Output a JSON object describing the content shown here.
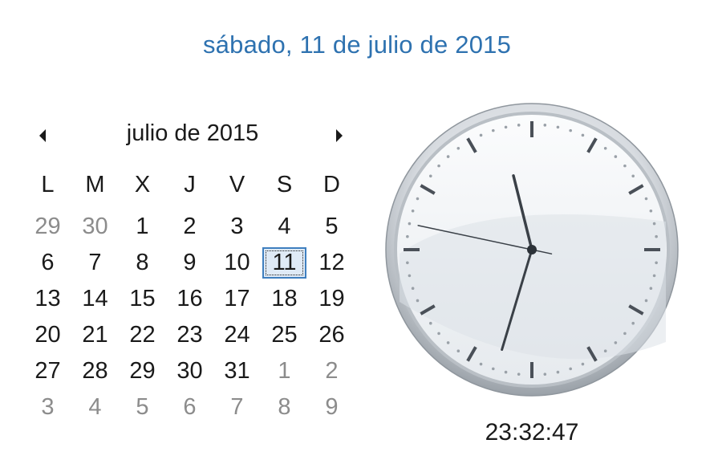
{
  "header": {
    "full_date": "sábado, 11 de julio de 2015"
  },
  "calendar": {
    "month_title": "julio de 2015",
    "prev_icon": "triangle-left",
    "next_icon": "triangle-right",
    "weekdays": [
      "L",
      "M",
      "X",
      "J",
      "V",
      "S",
      "D"
    ],
    "selected_day": "11",
    "days": [
      {
        "label": "29",
        "other": true
      },
      {
        "label": "30",
        "other": true
      },
      {
        "label": "1"
      },
      {
        "label": "2"
      },
      {
        "label": "3"
      },
      {
        "label": "4"
      },
      {
        "label": "5"
      },
      {
        "label": "6"
      },
      {
        "label": "7"
      },
      {
        "label": "8"
      },
      {
        "label": "9"
      },
      {
        "label": "10"
      },
      {
        "label": "11",
        "today": true
      },
      {
        "label": "12"
      },
      {
        "label": "13"
      },
      {
        "label": "14"
      },
      {
        "label": "15"
      },
      {
        "label": "16"
      },
      {
        "label": "17"
      },
      {
        "label": "18"
      },
      {
        "label": "19"
      },
      {
        "label": "20"
      },
      {
        "label": "21"
      },
      {
        "label": "22"
      },
      {
        "label": "23"
      },
      {
        "label": "24"
      },
      {
        "label": "25"
      },
      {
        "label": "26"
      },
      {
        "label": "27"
      },
      {
        "label": "28"
      },
      {
        "label": "29"
      },
      {
        "label": "30"
      },
      {
        "label": "31"
      },
      {
        "label": "1",
        "other": true
      },
      {
        "label": "2",
        "other": true
      },
      {
        "label": "3",
        "other": true
      },
      {
        "label": "4",
        "other": true
      },
      {
        "label": "5",
        "other": true
      },
      {
        "label": "6",
        "other": true
      },
      {
        "label": "7",
        "other": true
      },
      {
        "label": "8",
        "other": true
      },
      {
        "label": "9",
        "other": true
      }
    ]
  },
  "clock": {
    "time": "23:32:47",
    "hour": 23,
    "minute": 32,
    "second": 47,
    "face_color": "#eef1f4",
    "hand_color": "#3a4047"
  }
}
